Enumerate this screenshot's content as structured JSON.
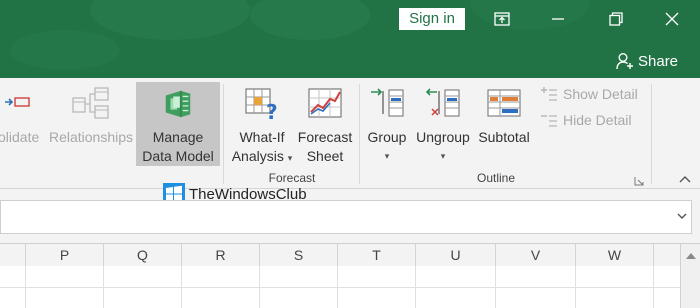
{
  "titlebar": {
    "sign_in_label": "Sign in",
    "share_label": "Share",
    "color": "#217346"
  },
  "ribbon": {
    "buttons": [
      {
        "label_line1": "olidate",
        "label_line2": ""
      },
      {
        "label_line1": "Relationships",
        "label_line2": ""
      },
      {
        "label_line1": "Manage",
        "label_line2": "Data Model"
      },
      {
        "label_line1": "What-If",
        "label_line2": "Analysis"
      },
      {
        "label_line1": "Forecast",
        "label_line2": "Sheet"
      },
      {
        "label_line1": "Group",
        "label_line2": ""
      },
      {
        "label_line1": "Ungroup",
        "label_line2": ""
      },
      {
        "label_line1": "Subtotal",
        "label_line2": ""
      }
    ],
    "show_detail": "Show Detail",
    "hide_detail": "Hide Detail",
    "groups": {
      "forecast": "Forecast",
      "outline": "Outline"
    }
  },
  "watermark": {
    "text": "TheWindowsClub"
  },
  "grid": {
    "columns": [
      "P",
      "Q",
      "R",
      "S",
      "T",
      "U",
      "V",
      "W"
    ]
  }
}
